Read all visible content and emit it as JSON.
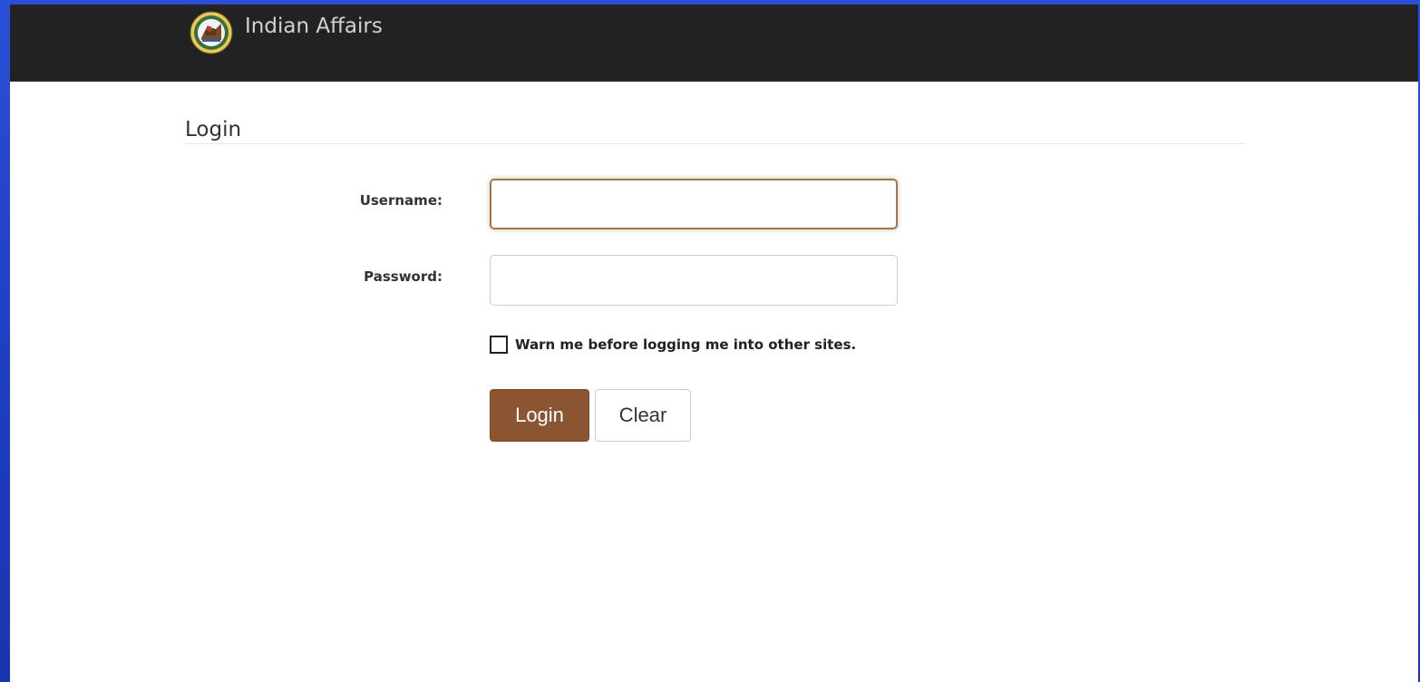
{
  "header": {
    "brand": "Indian Affairs",
    "logo_icon": "department-seal-icon"
  },
  "page": {
    "title": "Login"
  },
  "form": {
    "username_label": "Username:",
    "username_value": "",
    "password_label": "Password:",
    "password_value": "",
    "warn_checkbox_checked": false,
    "warn_label": "Warn me before logging me into other sites.",
    "login_button": "Login",
    "clear_button": "Clear"
  },
  "colors": {
    "navbar": "#222222",
    "login_button": "#8b5532",
    "focus_border": "#a0764c",
    "desktop_background": "#2a4fd6"
  }
}
